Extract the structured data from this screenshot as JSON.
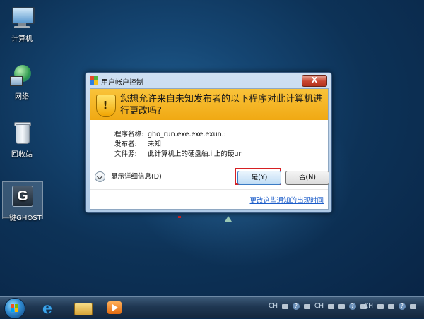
{
  "desktop": {
    "icons": [
      {
        "label": "计算机",
        "icon": "computer-icon"
      },
      {
        "label": "网络",
        "icon": "network-icon"
      },
      {
        "label": "回收站",
        "icon": "recycle-bin-icon"
      },
      {
        "label": "一键GHOST",
        "icon": "ghost-icon",
        "glyph": "G"
      }
    ]
  },
  "dialog": {
    "title": "用户帐户控制",
    "close_label": "X",
    "banner_text": "您想允许来自未知发布者的以下程序对此计算机进行更改吗?",
    "details": [
      {
        "key": "程序名称:",
        "value": "gho_run.exe.exe.exun.:"
      },
      {
        "key": "发布者:",
        "value": "未知"
      },
      {
        "key": "文件源:",
        "value": "此计算机上的硬盘紬.ii上的硬ur"
      }
    ],
    "show_details_label": "显示详细信息(D)",
    "yes_label": "是(Y)",
    "no_label": "否(N)",
    "settings_link": "更改这些通知的出现时间"
  },
  "taskbar": {
    "tray_groups": [
      {
        "lang": "CH"
      },
      {
        "lang": "CH"
      },
      {
        "lang": "CH"
      }
    ]
  },
  "colors": {
    "banner": "#f4b61f",
    "highlight": "#d62023",
    "link": "#1b5cc9"
  }
}
